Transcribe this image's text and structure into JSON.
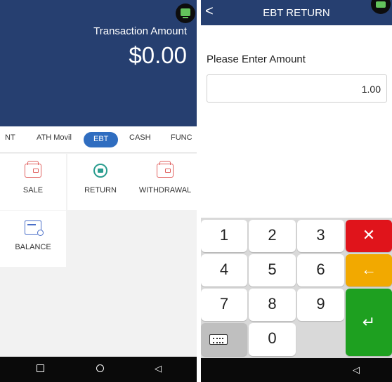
{
  "left": {
    "transaction_label": "Transaction Amount",
    "transaction_amount": "$0.00",
    "tabs": [
      "NT",
      "ATH Movil",
      "EBT",
      "CASH",
      "FUNC"
    ],
    "active_tab": "EBT",
    "tiles": [
      {
        "label": "SALE",
        "icon": "wallet-icon"
      },
      {
        "label": "RETURN",
        "icon": "return-icon"
      },
      {
        "label": "WITHDRAWAL",
        "icon": "wallet-icon"
      },
      {
        "label": "BALANCE",
        "icon": "card-search-icon"
      }
    ],
    "nav": {
      "square": "square-icon",
      "home": "circle-icon",
      "back": "◁"
    }
  },
  "right": {
    "title": "EBT RETURN",
    "back": "<",
    "prompt": "Please Enter Amount",
    "amount_value": "1.00",
    "keys": [
      "1",
      "2",
      "3",
      "4",
      "5",
      "6",
      "7",
      "8",
      "9",
      "0"
    ],
    "clear_glyph": "✕",
    "backspace_glyph": "←",
    "enter_glyph": "↵",
    "nav_back": "◁"
  },
  "colors": {
    "header_blue": "#263f70",
    "tab_active": "#2f6dc0",
    "clear_red": "#e0141b",
    "backspace_amber": "#f2a900",
    "enter_green": "#1ea020",
    "terminal_green": "#63c35c"
  }
}
